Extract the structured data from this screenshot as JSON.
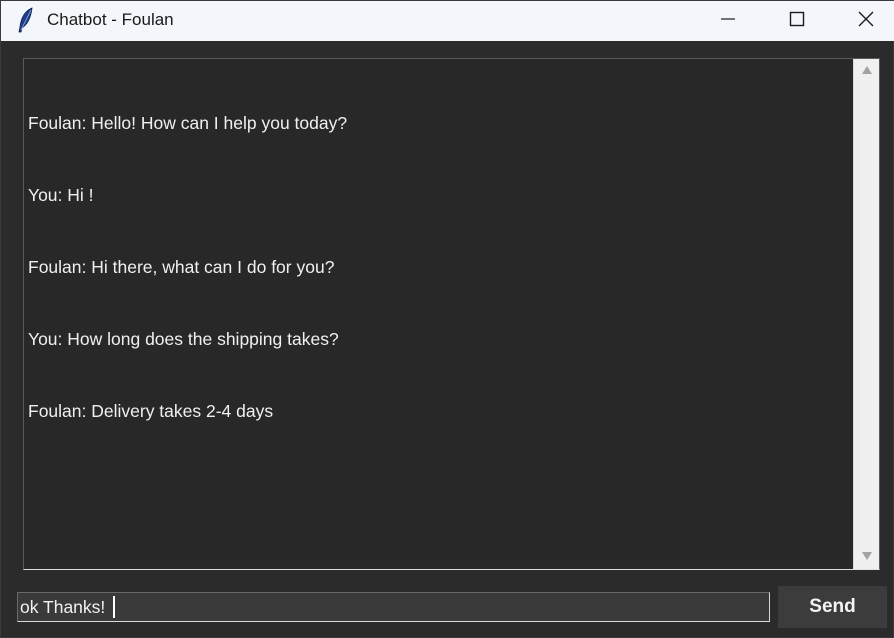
{
  "window": {
    "title": "Chatbot - Foulan",
    "app_icon": "feather-icon"
  },
  "title_controls": {
    "minimize_icon": "minimize-icon",
    "maximize_icon": "maximize-icon",
    "close_icon": "close-icon"
  },
  "chat": {
    "messages": [
      "Foulan: Hello! How can I help you today?",
      "You: Hi !",
      "Foulan: Hi there, what can I do for you?",
      "You: How long does the shipping takes?",
      "Foulan: Delivery takes 2-4 days"
    ]
  },
  "input": {
    "value": "ok Thanks!"
  },
  "send": {
    "label": "Send"
  },
  "colors": {
    "background": "#2b2b2b",
    "titlebar": "#f3f6fb",
    "text": "#f0f0f0",
    "button": "#3c3c3c"
  }
}
